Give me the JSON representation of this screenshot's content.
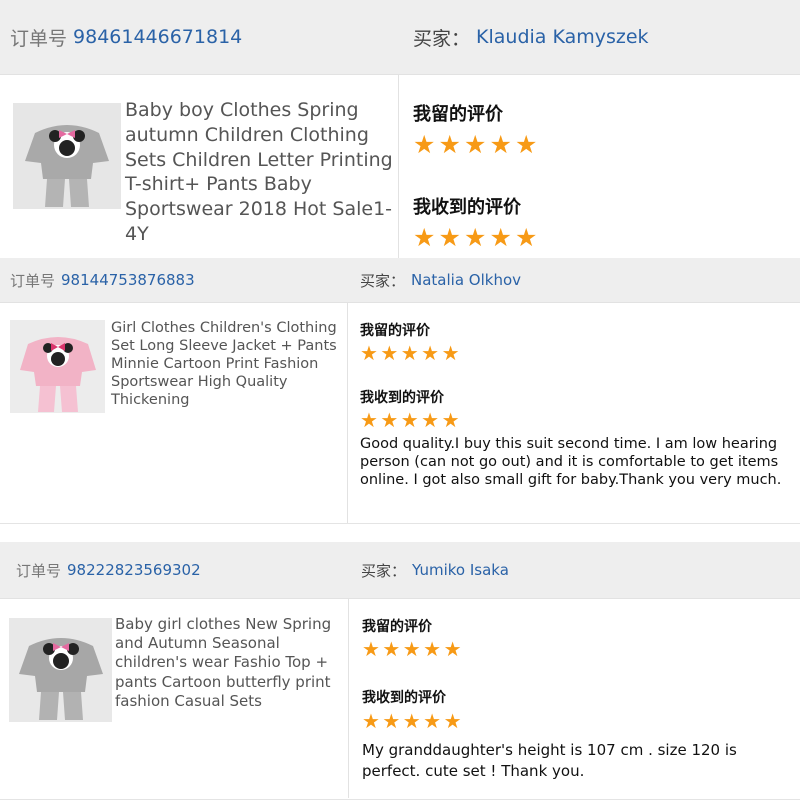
{
  "labels": {
    "order_no": "订单号",
    "buyer": "买家：",
    "my_review": "我留的评价",
    "received_review": "我收到的评价"
  },
  "colors": {
    "star": "#f79a16",
    "link": "#2a62a7",
    "header_bg": "#eeeeee"
  },
  "orders": [
    {
      "order_no": "98461446671814",
      "buyer": "Klaudia Kamyszek",
      "product": "Baby boy Clothes Spring autumn Children Clothing Sets Children Letter Printing T-shirt+ Pants Baby Sportswear 2018 Hot Sale1-4Y",
      "thumb_color": "gray",
      "my_rating": 5,
      "received_rating": 5,
      "comment": ""
    },
    {
      "order_no": "98144753876883",
      "buyer": "Natalia Olkhov",
      "product": "Girl Clothes Children's Clothing Set Long Sleeve Jacket + Pants Minnie Cartoon Print Fashion Sportswear High Quality Thickening",
      "thumb_color": "pink",
      "my_rating": 5,
      "received_rating": 5,
      "comment": "Good quality.I buy this suit second time. I am low hearing person (can not go out) and it is comfortable to get items online. I got also small gift for baby.Thank you very much."
    },
    {
      "order_no": "98222823569302",
      "buyer": "Yumiko Isaka",
      "product": "Baby girl clothes New Spring and Autumn Seasonal children's wear Fashio Top + pants Cartoon butterfly print fashion Casual Sets",
      "thumb_color": "gray",
      "my_rating": 5,
      "received_rating": 5,
      "comment": "My granddaughter's height is 107 cm . size 120 is perfect. cute set ! Thank you."
    }
  ]
}
